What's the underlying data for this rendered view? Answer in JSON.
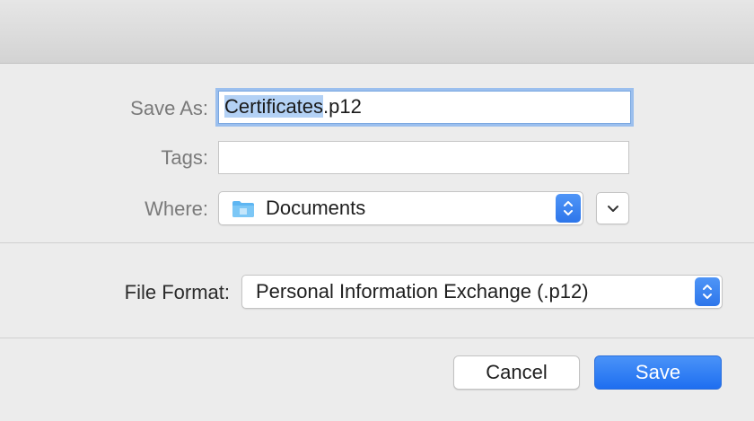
{
  "save_as": {
    "label": "Save As:",
    "filename_selected": "Certificates",
    "filename_extension": ".p12"
  },
  "tags": {
    "label": "Tags:",
    "value": ""
  },
  "where": {
    "label": "Where:",
    "value": "Documents",
    "icon": "folder-icon"
  },
  "file_format": {
    "label": "File Format:",
    "value": "Personal Information Exchange (.p12)"
  },
  "buttons": {
    "cancel": "Cancel",
    "save": "Save"
  },
  "colors": {
    "accent": "#2d76ea",
    "selection": "#b3d1f5",
    "folder": "#5eb6f2"
  }
}
